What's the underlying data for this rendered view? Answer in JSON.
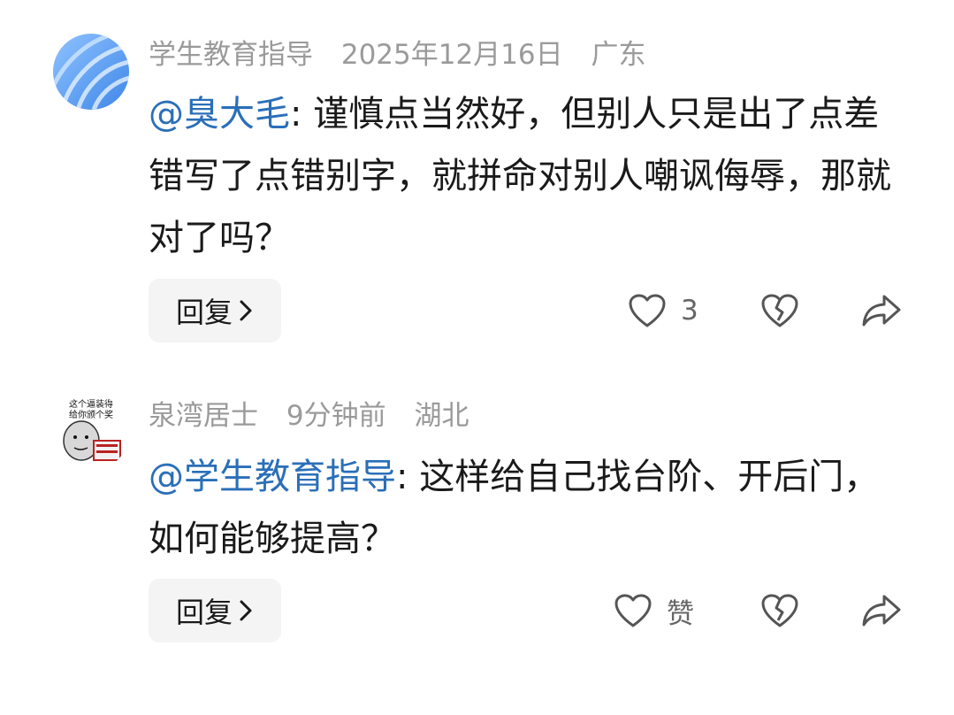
{
  "comments": [
    {
      "author": "学生教育指导",
      "date": "2025年12月16日",
      "location": "广东",
      "mention": "@臭大毛",
      "text": ": 谨慎点当然好，但别人只是出了点差错写了点错别字，就拼命对别人嘲讽侮辱，那就对了吗？",
      "reply_label": "回复",
      "like_count": "3",
      "avatar_icon": "blue-swirl-avatar"
    },
    {
      "author": "泉湾居士",
      "date": "9分钟前",
      "location": "湖北",
      "mention": "@学生教育指导",
      "text": ": 这样给自己找台阶、开后门，如何能够提高？",
      "reply_label": "回复",
      "like_count": "赞",
      "avatar_icon": "meme-face-avatar",
      "avatar_text_top": "这个逼装得",
      "avatar_text_mid": "给你颁个奖"
    }
  ],
  "colors": {
    "mention": "#2a6fb8",
    "meta": "#9a9a9a",
    "reply_bg": "#f4f4f4"
  }
}
